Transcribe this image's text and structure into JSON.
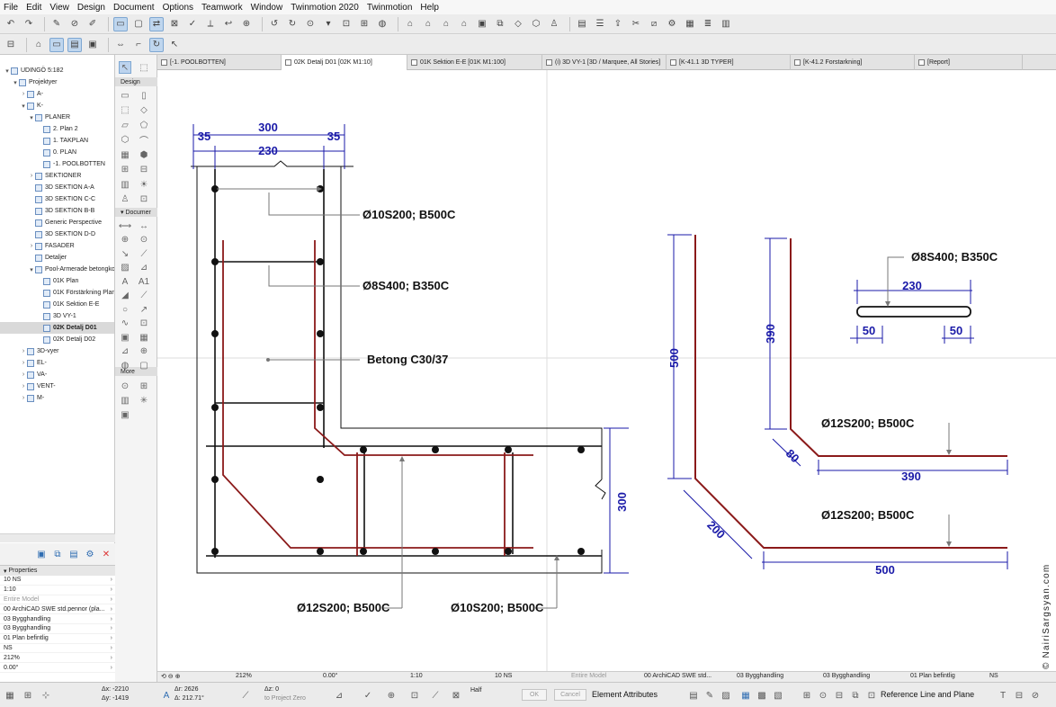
{
  "menu": [
    "File",
    "Edit",
    "View",
    "Design",
    "Document",
    "Options",
    "Teamwork",
    "Window",
    "Twinmotion 2020",
    "Twinmotion",
    "Help"
  ],
  "navigator": {
    "items": [
      {
        "label": "UDINGÖ 5:182",
        "level": 0,
        "tw": "▾",
        "sel": false
      },
      {
        "label": "Projektyer",
        "level": 1,
        "tw": "▾",
        "sel": false
      },
      {
        "label": "A-",
        "level": 2,
        "tw": "›",
        "sel": false
      },
      {
        "label": "K-",
        "level": 2,
        "tw": "▾",
        "sel": false
      },
      {
        "label": "PLANER",
        "level": 3,
        "tw": "▾",
        "sel": false
      },
      {
        "label": "2. Plan 2",
        "level": 4,
        "tw": "",
        "sel": false
      },
      {
        "label": "1. TAKPLAN",
        "level": 4,
        "tw": "",
        "sel": false
      },
      {
        "label": "0. PLAN",
        "level": 4,
        "tw": "",
        "sel": false
      },
      {
        "label": "-1. POOLBOTTEN",
        "level": 4,
        "tw": "",
        "sel": false
      },
      {
        "label": "SEKTIONER",
        "level": 3,
        "tw": "›",
        "sel": false
      },
      {
        "label": "3D SEKTION A-A",
        "level": 3,
        "tw": "",
        "sel": false
      },
      {
        "label": "3D SEKTION C-C",
        "level": 3,
        "tw": "",
        "sel": false
      },
      {
        "label": "3D SEKTION B-B",
        "level": 3,
        "tw": "",
        "sel": false
      },
      {
        "label": "Generic Perspective",
        "level": 3,
        "tw": "",
        "sel": false
      },
      {
        "label": "3D SEKTION D-D",
        "level": 3,
        "tw": "",
        "sel": false
      },
      {
        "label": "FASADER",
        "level": 3,
        "tw": "›",
        "sel": false
      },
      {
        "label": "Detaljer",
        "level": 3,
        "tw": "",
        "sel": false
      },
      {
        "label": "Pool-Armerade betongkonst",
        "level": 3,
        "tw": "▾",
        "sel": false
      },
      {
        "label": "01K Plan",
        "level": 4,
        "tw": "",
        "sel": false
      },
      {
        "label": "01K Förstärkning Plan",
        "level": 4,
        "tw": "",
        "sel": false
      },
      {
        "label": "01K Sektion E-E",
        "level": 4,
        "tw": "",
        "sel": false
      },
      {
        "label": "3D VY-1",
        "level": 4,
        "tw": "",
        "sel": false
      },
      {
        "label": "02K Detalj D01",
        "level": 4,
        "tw": "",
        "sel": true
      },
      {
        "label": "02K Detalj D02",
        "level": 4,
        "tw": "",
        "sel": false
      },
      {
        "label": "3D-vyer",
        "level": 2,
        "tw": "›",
        "sel": false
      },
      {
        "label": "EL-",
        "level": 2,
        "tw": "›",
        "sel": false
      },
      {
        "label": "VA-",
        "level": 2,
        "tw": "›",
        "sel": false
      },
      {
        "label": "VENT-",
        "level": 2,
        "tw": "›",
        "sel": false
      },
      {
        "label": "M-",
        "level": 2,
        "tw": "›",
        "sel": false
      }
    ]
  },
  "properties": {
    "title": "Properties",
    "rows": [
      {
        "label": "10 NS",
        "dim": false
      },
      {
        "label": "1:10",
        "dim": false
      },
      {
        "label": "Entire Model",
        "dim": true
      },
      {
        "label": "00 ArchiCAD SWE std.pennor (pla...",
        "dim": false
      },
      {
        "label": "03 Bygghandling",
        "dim": false
      },
      {
        "label": "03 Bygghandling",
        "dim": false
      },
      {
        "label": "01 Plan befintlig",
        "dim": false
      },
      {
        "label": "NS",
        "dim": false
      },
      {
        "label": "212%",
        "dim": false
      },
      {
        "label": "0.00°",
        "dim": false
      }
    ]
  },
  "toolbox": {
    "design": "Design",
    "document": "Documer",
    "more": "More"
  },
  "tabs": [
    {
      "label": "[-1. POOLBOTTEN]",
      "w": 138,
      "active": false
    },
    {
      "label": "02K Detalj D01  [02K M1:10]",
      "w": 140,
      "active": true
    },
    {
      "label": "01K Sektion E-E [01K M1:100]",
      "w": 150,
      "active": false
    },
    {
      "label": "(i) 3D VY-1 [3D / Marquee, All Stories]",
      "w": 138,
      "active": false
    },
    {
      "label": "[K-41.1 3D TYPER]",
      "w": 138,
      "active": false
    },
    {
      "label": "[K-41.2 Forstarkning]",
      "w": 138,
      "active": false
    },
    {
      "label": "[Report]",
      "w": 120,
      "active": false
    }
  ],
  "drawing": {
    "dim_top_total": "300",
    "dim_top_left": "35",
    "dim_top_mid": "230",
    "dim_top_right": "35",
    "label_rebar_top": "Ø10S200; B500C",
    "label_stirrup": "Ø8S400; B350C",
    "label_concrete": "Betong C30/37",
    "dim_slab": "300",
    "label_bottom_left": "Ø12S200; B500C",
    "label_bottom_right": "Ø10S200; B500C",
    "stirrup_label": "Ø8S400; B350C",
    "stirrup_dim_total": "230",
    "stirrup_dim_left": "50",
    "stirrup_dim_right": "50",
    "bar1_vert": "390",
    "bar1_diag": "80",
    "bar1_horiz": "390",
    "bar1_label": "Ø12S200; B500C",
    "bar2_vert": "500",
    "bar2_diag": "200",
    "bar2_horiz": "500",
    "bar2_label": "Ø12S200; B500C",
    "watermark": "© NairiSargsyan.com"
  },
  "colors": {
    "dim": "#1a1aa8",
    "rebar": "#8b1a1a",
    "line": "#111111",
    "accent": "#2f6db2"
  },
  "statusbar": {
    "zoom": "212%",
    "angle": "0.00°",
    "scale": "1:10",
    "layer": "10 NS",
    "model": "Entire Model",
    "pen": "00 ArchiCAD SWE std...",
    "g1": "03 Bygghandling",
    "g2": "03 Bygghandling",
    "plan": "01 Plan befintlig",
    "ns": "NS"
  },
  "infobar": {
    "dx": "Δx: -2210",
    "dy": "Δy: -1419",
    "ar": "Δr: 2626",
    "aang": "Δ: 212.71°",
    "dz": "Δz: 0",
    "zero": "to Project Zero",
    "half": "Half",
    "ok": "OK",
    "cancel": "Cancel",
    "elem_attr": "Element Attributes",
    "ref_line": "Reference Line and Plane"
  }
}
